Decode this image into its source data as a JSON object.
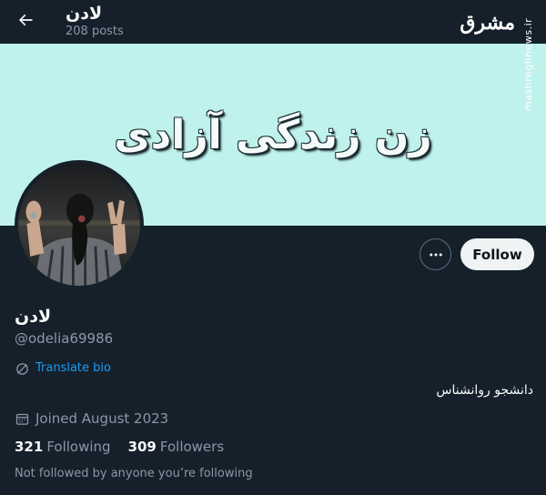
{
  "header": {
    "back_icon": "arrow-left-icon",
    "name": "لادن",
    "post_count": "208 posts"
  },
  "watermark": {
    "logo_text": "مشرق",
    "url": "mashreghnews.ir"
  },
  "banner": {
    "text": "زن زندگی آزادی",
    "background_color": "#bff2ec"
  },
  "actions": {
    "more_icon": "more-dots-icon",
    "follow_label": "Follow"
  },
  "profile": {
    "display_name": "لادن",
    "handle": "@odelia69986",
    "translate_label": "Translate bio",
    "bio": "دانشجو روانشناس",
    "joined": "Joined August 2023",
    "following_count": "321",
    "following_label": "Following",
    "followers_count": "309",
    "followers_label": "Followers",
    "not_followed_text": "Not followed by anyone you’re following"
  },
  "colors": {
    "background": "#15202b",
    "accent_link": "#1d9bf0",
    "secondary_text": "#8b98a5"
  }
}
